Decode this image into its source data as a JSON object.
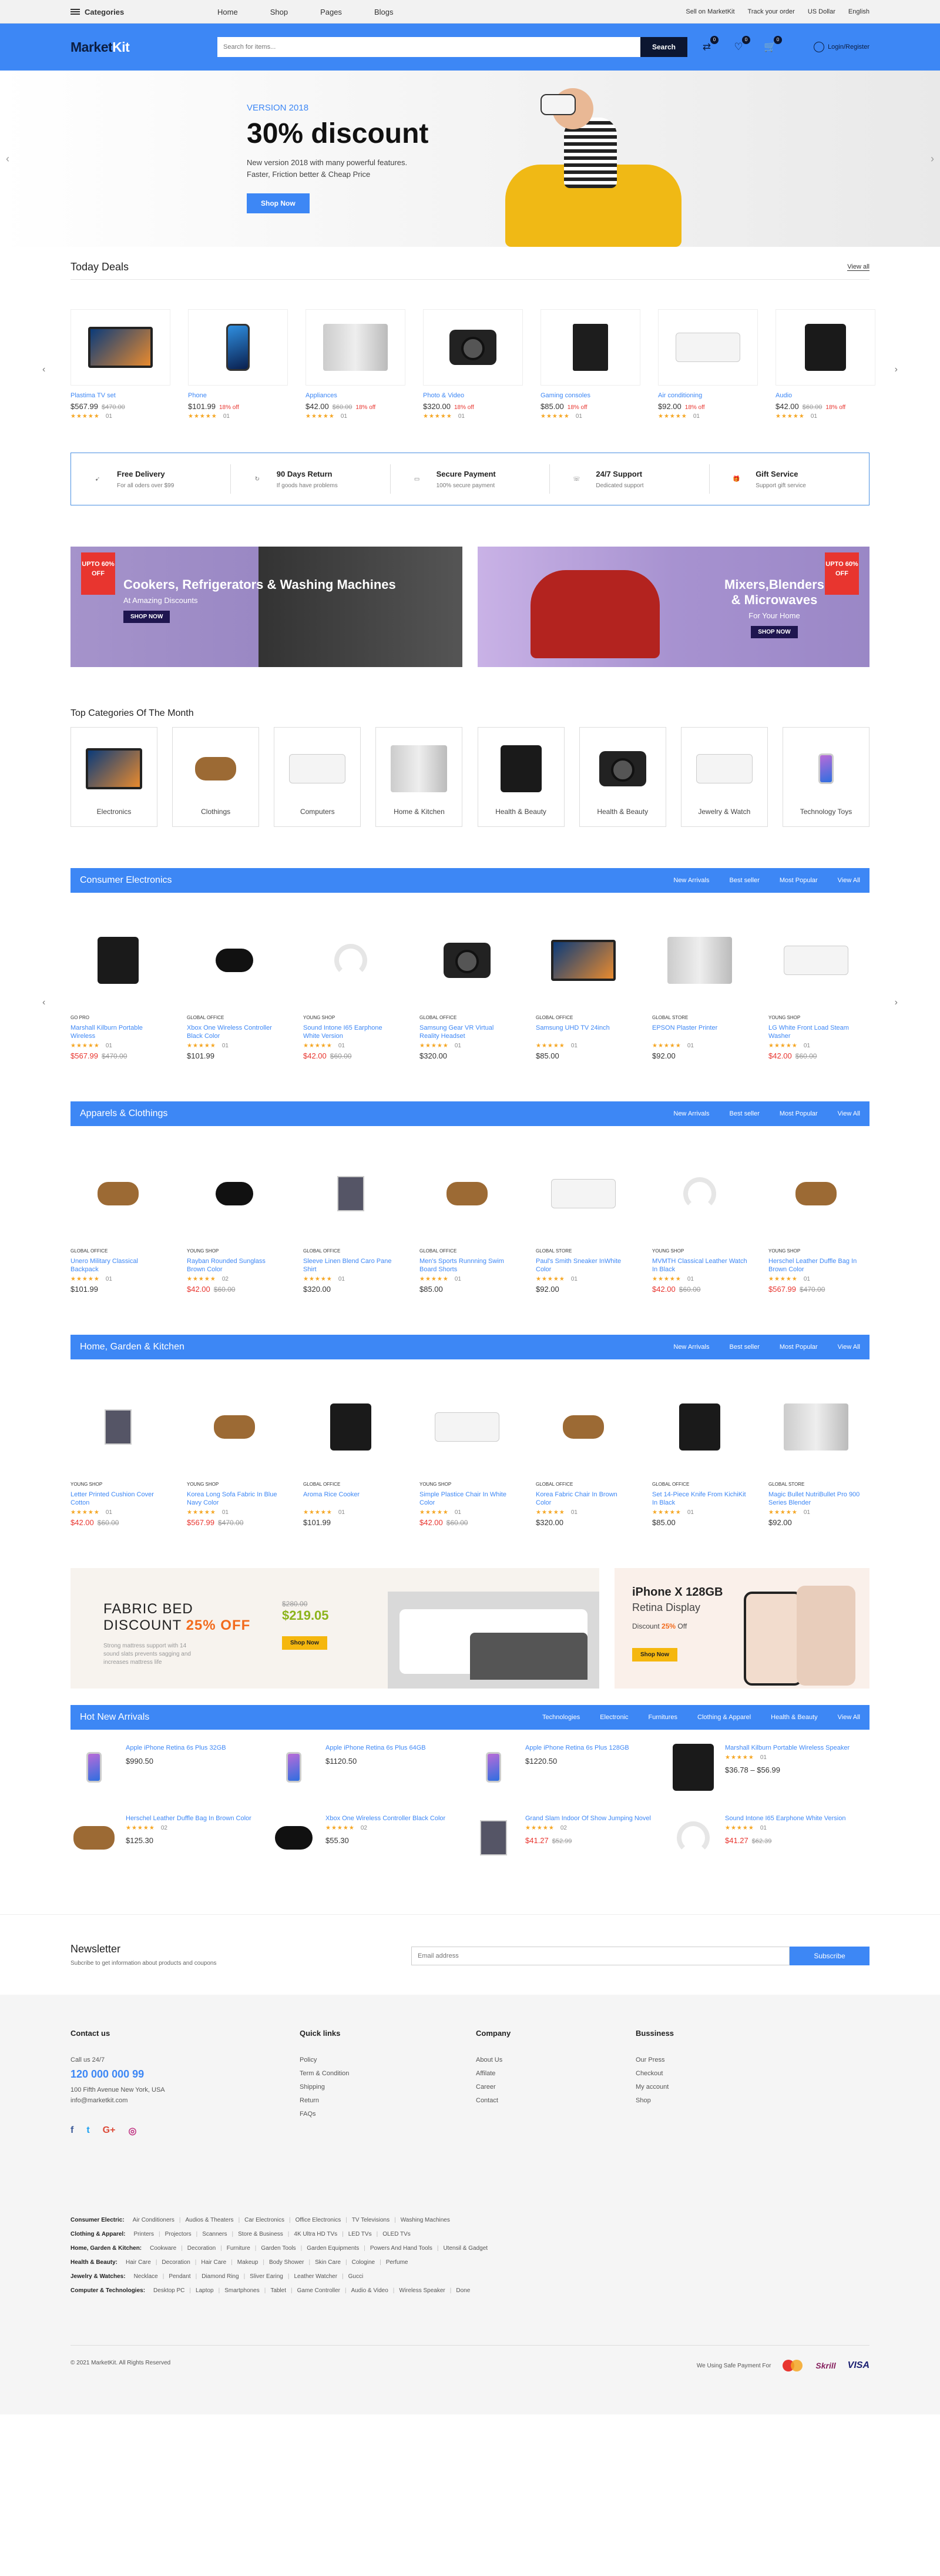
{
  "topbar": {
    "categories_label": "Categories",
    "nav": [
      "Home",
      "Shop",
      "Pages",
      "Blogs"
    ],
    "links": [
      "Sell on MarketKit",
      "Track your order",
      "US Dollar",
      "English"
    ]
  },
  "header": {
    "logo_a": "Market",
    "logo_b": "Kit",
    "search_placeholder": "Search for items...",
    "search_button": "Search",
    "icons": [
      {
        "name": "compare-icon",
        "badge": "0"
      },
      {
        "name": "wishlist-icon",
        "badge": "0"
      },
      {
        "name": "cart-icon",
        "badge": "0"
      }
    ],
    "login": "Login/Register"
  },
  "hero": {
    "version": "VERSION 2018",
    "headline": "30% discount",
    "line1": "New version 2018 with many powerful features.",
    "line2": "Faster, Friction better & Cheap Price",
    "button": "Shop Now"
  },
  "deals": {
    "title": "Today Deals",
    "view_all": "View all",
    "items": [
      {
        "name": "Plastima TV set",
        "price": "$567.99",
        "old": "$470.00",
        "off": "",
        "rating": "01",
        "icon": "tv"
      },
      {
        "name": "Phone",
        "price": "$101.99",
        "old": "",
        "off": "18% off",
        "rating": "01",
        "icon": "phone"
      },
      {
        "name": "Appliances",
        "price": "$42.00",
        "old": "$60.00",
        "off": "18% off",
        "rating": "01",
        "icon": "appliance"
      },
      {
        "name": "Photo & Video",
        "price": "$320.00",
        "old": "",
        "off": "18% off",
        "rating": "01",
        "icon": "camera"
      },
      {
        "name": "Gaming consoles",
        "price": "$85.00",
        "old": "",
        "off": "18% off",
        "rating": "01",
        "icon": "console"
      },
      {
        "name": "Air conditioning",
        "price": "$92.00",
        "old": "",
        "off": "18% off",
        "rating": "01",
        "icon": "ac"
      },
      {
        "name": "Audio",
        "price": "$42.00",
        "old": "$60.00",
        "off": "18% off",
        "rating": "01",
        "icon": "speaker"
      }
    ]
  },
  "features": [
    {
      "title": "Free Delivery",
      "sub": "For all oders over $99",
      "icon": "rocket-icon",
      "glyph": "➹"
    },
    {
      "title": "90 Days Return",
      "sub": "If goods have problems",
      "icon": "return-icon",
      "glyph": "↻"
    },
    {
      "title": "Secure Payment",
      "sub": "100% secure payment",
      "icon": "card-icon",
      "glyph": "▭"
    },
    {
      "title": "24/7 Support",
      "sub": "Dedicated support",
      "icon": "chat-icon",
      "glyph": "☏"
    },
    {
      "title": "Gift Service",
      "sub": "Support gift service",
      "icon": "gift-icon",
      "glyph": "🎁"
    }
  ],
  "promos": [
    {
      "title": "Cookers, Refrigerators & Washing Machines",
      "sub": "At Amazing Discounts",
      "button": "SHOP NOW",
      "tag": "UPTO 60% OFF"
    },
    {
      "title": "Mixers,Blenders & Microwaves",
      "sub": "For Your Home",
      "button": "SHOP NOW",
      "tag": "UPTO 60% OFF"
    }
  ],
  "top_categories": {
    "title": "Top Categories Of The Month",
    "items": [
      "Electronics",
      "Clothings",
      "Computers",
      "Home & Kitchen",
      "Health & Beauty",
      "Health & Beauty",
      "Jewelry & Watch",
      "Technology Toys"
    ]
  },
  "blocks": [
    {
      "title": "Consumer Electronics",
      "tabs": [
        "New Arrivals",
        "Best seller",
        "Most Popular",
        "View All"
      ],
      "products": [
        {
          "shop": "GO PRO",
          "name": "Marshall Kilburn Portable Wireless",
          "price": "$567.99",
          "old": "$470.00",
          "sale": true,
          "rating": "01"
        },
        {
          "shop": "GLOBAL OFFICE",
          "name": "Xbox One Wireless Controller Black Color",
          "price": "$101.99",
          "old": "",
          "sale": false,
          "rating": "01"
        },
        {
          "shop": "YOUNG SHOP",
          "name": "Sound Intone I65 Earphone White Version",
          "price": "$42.00",
          "old": "$60.00",
          "sale": true,
          "rating": "01"
        },
        {
          "shop": "GLOBAL OFFICE",
          "name": "Samsung Gear VR Virtual Reality Headset",
          "price": "$320.00",
          "old": "",
          "sale": false,
          "rating": "01"
        },
        {
          "shop": "GLOBAL OFFICE",
          "name": "Samsung UHD TV 24inch",
          "price": "$85.00",
          "old": "",
          "sale": false,
          "rating": "01"
        },
        {
          "shop": "GLOBAL STORE",
          "name": "EPSON Plaster Printer",
          "price": "$92.00",
          "old": "",
          "sale": false,
          "rating": "01"
        },
        {
          "shop": "YOUNG SHOP",
          "name": "LG White Front Load Steam Washer",
          "price": "$42.00",
          "old": "$60.00",
          "sale": true,
          "rating": "01"
        }
      ]
    },
    {
      "title": "Apparels & Clothings",
      "tabs": [
        "New Arrivals",
        "Best seller",
        "Most Popular",
        "View All"
      ],
      "products": [
        {
          "shop": "GLOBAL OFFICE",
          "name": "Unero Military Classical Backpack",
          "price": "$101.99",
          "old": "",
          "sale": false,
          "rating": "01"
        },
        {
          "shop": "YOUNG SHOP",
          "name": "Rayban Rounded Sunglass Brown Color",
          "price": "$42.00",
          "old": "$60.00",
          "sale": true,
          "rating": "02"
        },
        {
          "shop": "GLOBAL OFFICE",
          "name": "Sleeve Linen Blend Caro Pane Shirt",
          "price": "$320.00",
          "old": "",
          "sale": false,
          "rating": "01"
        },
        {
          "shop": "GLOBAL OFFICE",
          "name": "Men's Sports Runnning Swim Board Shorts",
          "price": "$85.00",
          "old": "",
          "sale": false,
          "rating": "01"
        },
        {
          "shop": "GLOBAL STORE",
          "name": "Paul's Smith Sneaker InWhite Color",
          "price": "$92.00",
          "old": "",
          "sale": false,
          "rating": "01"
        },
        {
          "shop": "YOUNG SHOP",
          "name": "MVMTH Classical Leather Watch In Black",
          "price": "$42.00",
          "old": "$60.00",
          "sale": true,
          "rating": "01"
        },
        {
          "shop": "YOUNG SHOP",
          "name": "Herschel Leather Duffle Bag In Brown Color",
          "price": "$567.99",
          "old": "$470.00",
          "sale": true,
          "rating": "01"
        }
      ]
    },
    {
      "title": "Home, Garden & Kitchen",
      "tabs": [
        "New Arrivals",
        "Best seller",
        "Most Popular",
        "View All"
      ],
      "products": [
        {
          "shop": "YOUNG SHOP",
          "name": "Letter Printed Cushion Cover Cotton",
          "price": "$42.00",
          "old": "$60.00",
          "sale": true,
          "rating": "01"
        },
        {
          "shop": "YOUNG SHOP",
          "name": "Korea Long Sofa Fabric In Blue Navy Color",
          "price": "$567.99",
          "old": "$470.00",
          "sale": true,
          "rating": "01"
        },
        {
          "shop": "GLOBAL OFFICE",
          "name": "Aroma Rice Cooker",
          "price": "$101.99",
          "old": "",
          "sale": false,
          "rating": "01"
        },
        {
          "shop": "YOUNG SHOP",
          "name": "Simple Plastice Chair In White Color",
          "price": "$42.00",
          "old": "$60.00",
          "sale": true,
          "rating": "01"
        },
        {
          "shop": "GLOBAL OFFICE",
          "name": "Korea Fabric Chair In Brown Color",
          "price": "$320.00",
          "old": "",
          "sale": false,
          "rating": "01"
        },
        {
          "shop": "GLOBAL OFFICE",
          "name": "Set 14-Piece Knife From KichiKit In Black",
          "price": "$85.00",
          "old": "",
          "sale": false,
          "rating": "01"
        },
        {
          "shop": "GLOBAL STORE",
          "name": "Magic Bullet NutriBullet Pro 900 Series Blender",
          "price": "$92.00",
          "old": "",
          "sale": false,
          "rating": "01"
        }
      ]
    }
  ],
  "fabric": {
    "line1": "FABRIC BED",
    "line2": "DISCOUNT",
    "pct": "25% OFF",
    "desc": "Strong mattress support with 14 sound slats prevents sagging and increases mattress life",
    "old": "$280.00",
    "new": "$219.05",
    "button": "Shop Now"
  },
  "iphone": {
    "title": "iPhone X 128GB",
    "sub": "Retina Display",
    "disc": "Discount",
    "pct": "25%",
    "off": "Off",
    "button": "Shop Now"
  },
  "hot": {
    "title": "Hot New Arrivals",
    "tabs": [
      "Technologies",
      "Electronic",
      "Furnitures",
      "Clothing & Apparel",
      "Health & Beauty",
      "View All"
    ],
    "items": [
      {
        "name": "Apple iPhone Retina 6s Plus 32GB",
        "price": "$990.50",
        "old": "",
        "sale": false,
        "rating": "",
        "img": "iphone"
      },
      {
        "name": "Apple iPhone Retina 6s Plus 64GB",
        "price": "$1120.50",
        "old": "",
        "sale": false,
        "rating": "",
        "img": "iphone"
      },
      {
        "name": "Apple iPhone Retina 6s Plus 128GB",
        "price": "$1220.50",
        "old": "",
        "sale": false,
        "rating": "",
        "img": "iphone"
      },
      {
        "name": "Marshall Kilburn Portable Wireless Speaker",
        "price": "$36.78 – $56.99",
        "old": "",
        "sale": false,
        "rating": "01",
        "img": "speaker"
      },
      {
        "name": "Herschel Leather Duffle Bag In Brown Color",
        "price": "$125.30",
        "old": "",
        "sale": false,
        "rating": "02",
        "img": "bag"
      },
      {
        "name": "Xbox One Wireless Controller Black Color",
        "price": "$55.30",
        "old": "",
        "sale": false,
        "rating": "02",
        "img": "controller"
      },
      {
        "name": "Grand Slam Indoor Of Show Jumping Novel",
        "price": "$41.27",
        "old": "$52.99",
        "sale": true,
        "rating": "02",
        "img": "book"
      },
      {
        "name": "Sound Intone I65 Earphone White Version",
        "price": "$41.27",
        "old": "$62.39",
        "sale": true,
        "rating": "01",
        "img": "headphone"
      }
    ]
  },
  "newsletter": {
    "title": "Newsletter",
    "sub": "Subcribe to get information about products and coupons",
    "placeholder": "Email address",
    "button": "Subscribe"
  },
  "footer": {
    "contact": {
      "title": "Contact us",
      "call": "Call us 24/7",
      "phone": "120 000 000 99",
      "address": "100 Fifth Avenue New York, USA",
      "email": "info@marketkit.com"
    },
    "social": [
      "f",
      "t",
      "G+",
      "◎"
    ],
    "cols": [
      {
        "title": "Quick links",
        "items": [
          "Policy",
          "Term & Condition",
          "Shipping",
          "Return",
          "FAQs"
        ]
      },
      {
        "title": "Company",
        "items": [
          "About Us",
          "Affilate",
          "Career",
          "Contact"
        ]
      },
      {
        "title": "Bussiness",
        "items": [
          "Our Press",
          "Checkout",
          "My account",
          "Shop"
        ]
      }
    ],
    "cat_rows": [
      {
        "label": "Consumer Electric:",
        "items": [
          "Air Conditioners",
          "Audios & Theaters",
          "Car Electronics",
          "Office Electronics",
          "TV Televisions",
          "Washing Machines"
        ]
      },
      {
        "label": "Clothing & Apparel:",
        "items": [
          "Printers",
          "Projectors",
          "Scanners",
          "Store & Business",
          "4K Ultra HD TVs",
          "LED TVs",
          "OLED TVs"
        ]
      },
      {
        "label": "Home, Garden & Kitchen:",
        "items": [
          "Cookware",
          "Decoration",
          "Furniture",
          "Garden Tools",
          "Garden Equipments",
          "Powers And Hand Tools",
          "Utensil & Gadget"
        ]
      },
      {
        "label": "Health & Beauty:",
        "items": [
          "Hair Care",
          "Decoration",
          "Hair Care",
          "Makeup",
          "Body Shower",
          "Skin Care",
          "Cologine",
          "Perfume"
        ]
      },
      {
        "label": "Jewelry & Watches:",
        "items": [
          "Necklace",
          "Pendant",
          "Diamond Ring",
          "Sliver Earing",
          "Leather Watcher",
          "Gucci"
        ]
      },
      {
        "label": "Computer & Technologies:",
        "items": [
          "Desktop PC",
          "Laptop",
          "Smartphones",
          "Tablet",
          "Game Controller",
          "Audio & Video",
          "Wireless Speaker",
          "Done"
        ]
      }
    ],
    "copyright": "© 2021 MarketKit. All Rights Reserved",
    "pay_label": "We Using Safe Payment For",
    "skrill": "Skrill",
    "visa": "VISA"
  },
  "colors": {
    "accent": "#3d87f5",
    "dark": "#0c1631",
    "sale": "#e8352f",
    "star": "#f5a623"
  }
}
